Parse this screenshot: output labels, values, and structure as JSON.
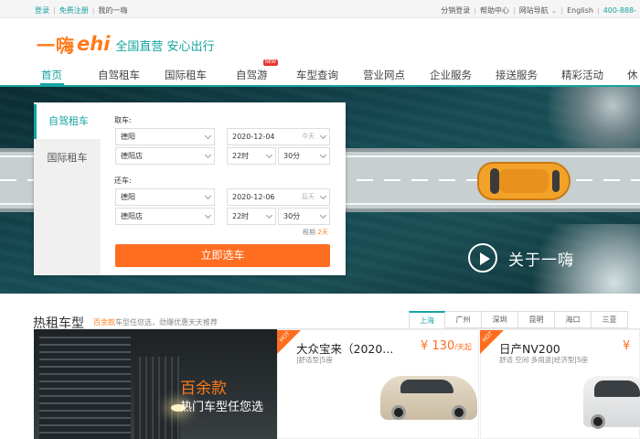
{
  "topbar": {
    "login": "登录",
    "register": "免费注册",
    "my_account": "我的一嗨",
    "distributor_login": "分销登录",
    "help_center": "帮助中心",
    "site_nav": "网站导航",
    "english": "English",
    "phone": "400-888-"
  },
  "header": {
    "logo_cn": "一嗨",
    "logo_en": "ehi",
    "slogan": "全国直营 安心出行"
  },
  "nav": {
    "items": [
      "首页",
      "自驾租车",
      "国际租车",
      "自驾游",
      "车型查询",
      "营业网点",
      "企业服务",
      "接送服务",
      "精彩活动",
      "休"
    ],
    "new_badge": "NEW"
  },
  "booking": {
    "tabs": [
      "自驾租车",
      "国际租车"
    ],
    "pickup_label": "取车:",
    "return_label": "还车:",
    "pickup_city": "德阳",
    "pickup_store": "德阳店",
    "pickup_date": "2020-12-04",
    "pickup_day": "今天",
    "pickup_hour": "22时",
    "pickup_minute": "30分",
    "return_city": "德阳",
    "return_store": "德阳店",
    "return_date": "2020-12-06",
    "return_day": "后天",
    "return_hour": "22时",
    "return_minute": "30分",
    "duration_label": "租期",
    "duration_value": "2天",
    "submit": "立即选车"
  },
  "hero": {
    "about": "关于一嗨"
  },
  "hot": {
    "title": "热租车型",
    "subtitle_highlight": "百余款",
    "subtitle_rest": "车型任您选，劲爆优惠天天推荐",
    "cities": [
      "上海",
      "广州",
      "深圳",
      "昆明",
      "海口",
      "三亚"
    ],
    "promo_line1": "百余款",
    "promo_line2": "热门车型任您选",
    "hot_label": "HOT",
    "cars": [
      {
        "name": "大众宝来（2020...",
        "spec": "|舒适型|5座",
        "price": "¥ 130",
        "unit": "/天起"
      },
      {
        "name": "日产NV200",
        "spec": "舒适 空间 多用途|经济型|5座",
        "price": "¥"
      }
    ]
  },
  "colors": {
    "accent": "#15a3a0",
    "orange": "#ff6d1f"
  }
}
